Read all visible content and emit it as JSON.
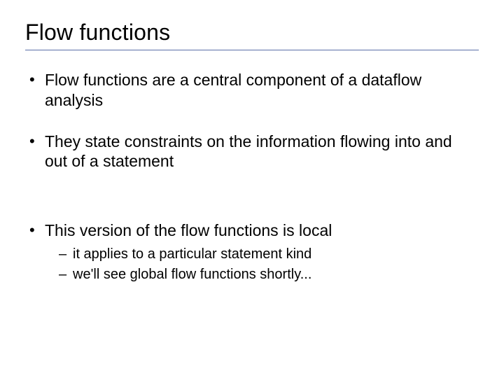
{
  "title": "Flow functions",
  "bullets": [
    {
      "text": "Flow functions are a central component of a dataflow analysis",
      "sub": []
    },
    {
      "text": "They state constraints on the information flowing into and out of a statement",
      "sub": []
    },
    {
      "text": "This version of the flow functions is local",
      "sub": [
        "it applies to a particular statement kind",
        "we'll see global flow functions shortly..."
      ]
    }
  ]
}
